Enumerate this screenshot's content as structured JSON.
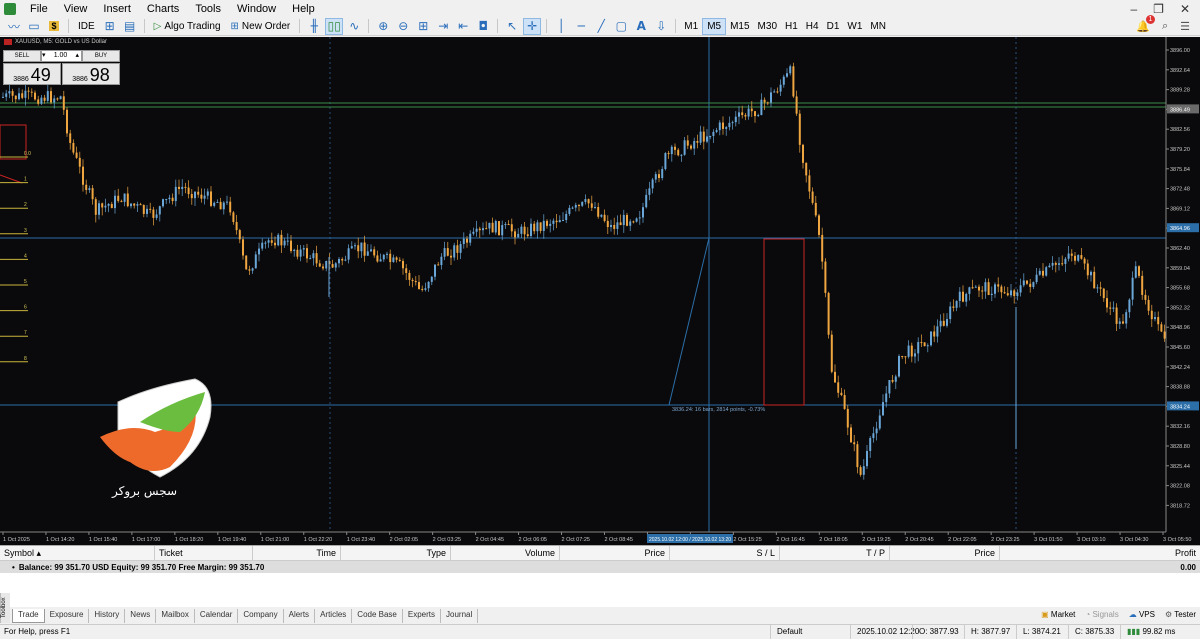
{
  "menu": [
    "File",
    "View",
    "Insert",
    "Charts",
    "Tools",
    "Window",
    "Help"
  ],
  "toolbar": {
    "ide_label": "IDE",
    "algo_label": "Algo Trading",
    "new_order_label": "New Order",
    "timeframes": [
      "M1",
      "M5",
      "M15",
      "M30",
      "H1",
      "H4",
      "D1",
      "W1",
      "MN"
    ],
    "active_timeframe": "M5",
    "notification_count": "1"
  },
  "chart": {
    "title": "XAUUSD, M5:  GOLD vs US Dollar",
    "trade_panel": {
      "sell_label": "SELL",
      "buy_label": "BUY",
      "lot": "1.00",
      "sell_small": "3886",
      "sell_big": "49",
      "buy_small": "3886",
      "buy_big": "98"
    },
    "price_labels": [
      "3896.00",
      "3892.64",
      "3889.28",
      "3886.49",
      "3882.56",
      "3879.20",
      "3875.84",
      "3872.48",
      "3869.12",
      "3864.96",
      "3862.40",
      "3859.04",
      "3855.68",
      "3852.32",
      "3848.96",
      "3845.60",
      "3842.24",
      "3838.88",
      "3834.24",
      "3832.16",
      "3828.80",
      "3825.44",
      "3822.08",
      "3818.72"
    ],
    "time_labels": [
      "1 Oct 2025",
      "1 Oct 14:20",
      "1 Oct 15:40",
      "1 Oct 17:00",
      "1 Oct 18:20",
      "1 Oct 19:40",
      "1 Oct 21:00",
      "1 Oct 22:20",
      "1 Oct 23:40",
      "2 Oct 02:05",
      "2 Oct 03:25",
      "2 Oct 04:45",
      "2 Oct 06:05",
      "2 Oct 07:25",
      "2 Oct 08:45",
      "2 Oct 10:05",
      "2 Oct 14:45",
      "2 Oct 15:25",
      "2 Oct 16:45",
      "2 Oct 18:05",
      "2 Oct 19:25",
      "2 Oct 20:45",
      "2 Oct 22:05",
      "2 Oct 23:25",
      "3 Oct 01:50",
      "3 Oct 03:10",
      "3 Oct 04:30",
      "3 Oct 05:50"
    ],
    "fib_levels": [
      "0.0",
      "1",
      "2",
      "3",
      "4",
      "5",
      "6",
      "7",
      "8"
    ],
    "measure_text": "3836.24: 16 bars, 2814 points, -0.73%",
    "highlighted_time": "2025.10.02 12:00 / 2025.10.02 13:20",
    "logo_text": "سجس بروکر",
    "colors": {
      "bull": "#6aa7d8",
      "bear": "#f0a640",
      "line": "#2b6ea8",
      "rect": "#cc2222",
      "green": "#2e8b3a"
    }
  },
  "tradebox": {
    "columns": [
      "Symbol",
      "Ticket",
      "Time",
      "Type",
      "Volume",
      "Price",
      "S / L",
      "T / P",
      "Price",
      "Profit"
    ],
    "balance_text": "Balance: 99 351.70 USD  Equity: 99 351.70  Free Margin: 99 351.70",
    "profit": "0.00",
    "toolbox_label": "Toolbox"
  },
  "tabs": [
    "Trade",
    "Exposure",
    "History",
    "News",
    "Mailbox",
    "Calendar",
    "Company",
    "Alerts",
    "Articles",
    "Code Base",
    "Experts",
    "Journal"
  ],
  "tabs_right": {
    "market": "Market",
    "signals": "Signals",
    "vps": "VPS",
    "tester": "Tester"
  },
  "status": {
    "help": "For Help, press F1",
    "profile": "Default",
    "datetime": "2025.10.02 12:20",
    "open": "O: 3877.93",
    "high": "H: 3877.97",
    "low": "L: 3874.21",
    "close": "C: 3875.33",
    "net": "99.82 ms"
  }
}
